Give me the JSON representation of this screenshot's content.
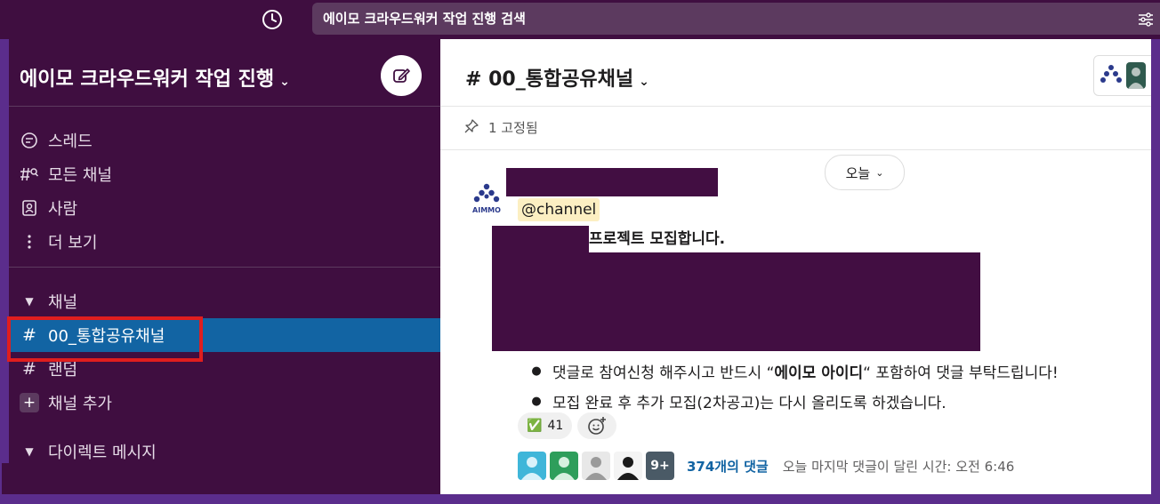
{
  "topbar": {
    "search_text": "에이모 크라우드워커 작업 진행 검색"
  },
  "sidebar": {
    "workspace_name": "에이모 크라우드워커 작업 진행",
    "nav_items": [
      {
        "label": "스레드",
        "icon": "threads-icon"
      },
      {
        "label": "모든 채널",
        "icon": "channel-search-icon"
      },
      {
        "label": "사람",
        "icon": "people-icon"
      },
      {
        "label": "더 보기",
        "icon": "more-vertical-icon"
      }
    ],
    "channels_section": "채널",
    "channels": [
      {
        "label": "00_통합공유채널",
        "active": true
      },
      {
        "label": "랜덤",
        "active": false
      }
    ],
    "add_channel": "채널 추가",
    "dm_section": "다이렉트 메시지"
  },
  "channel": {
    "name": "# 00_통합공유채널",
    "pinned": "1 고정됨",
    "date_divider": "오늘"
  },
  "message": {
    "avatar_label": "AIMMO",
    "mention": "@channel",
    "recruit_text": "프로젝트 모집합니다.",
    "bullets": [
      {
        "pre": "댓글로 참여신청 해주시고 반드시 “",
        "bold": "에이모 아이디",
        "post": "“ 포함하여 댓글 부탁드립니다!"
      },
      {
        "pre": "모집 완료 후 추가 모집(2차공고)는 다시 올리도록 하겠습니다.",
        "bold": "",
        "post": ""
      }
    ],
    "reactions": [
      {
        "emoji": "✅",
        "count": "41"
      }
    ],
    "thread": {
      "more_badge": "9+",
      "count": "374개의 댓글",
      "last_reply": "오늘 마지막 댓글이 달린 시간: 오전 6:46"
    }
  },
  "colors": {
    "sidebar_bg": "#3f0e40",
    "active_channel": "#1264a3",
    "highlight_box": "#e01e1e",
    "mention_bg": "#fcefc2",
    "link": "#1264a3"
  }
}
